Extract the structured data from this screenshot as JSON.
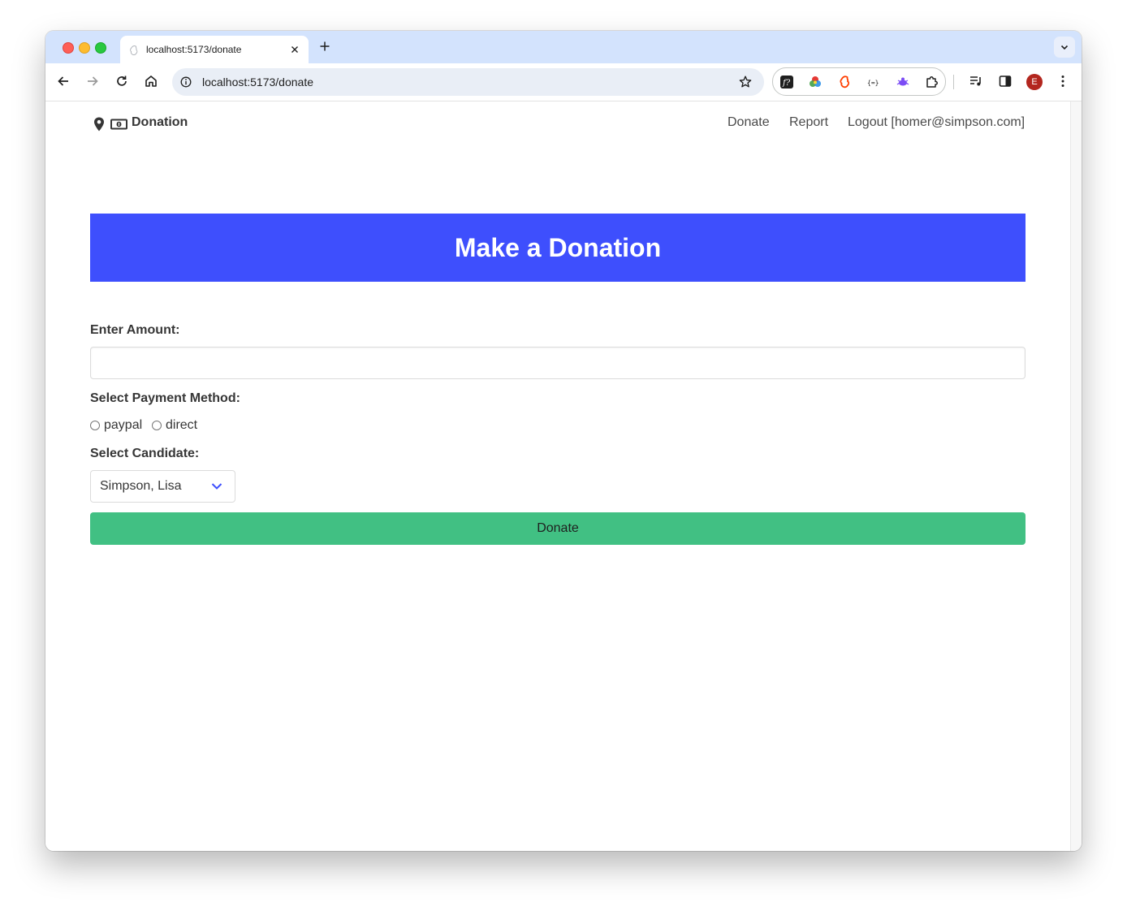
{
  "browser": {
    "tab_title": "localhost:5173/donate",
    "url": "localhost:5173/donate",
    "profile_initial": "E"
  },
  "navbar": {
    "brand": "Donation",
    "links": [
      "Donate",
      "Report",
      "Logout [homer@simpson.com]"
    ]
  },
  "hero": {
    "title": "Make a Donation"
  },
  "form": {
    "amount_label": "Enter Amount:",
    "amount_value": "",
    "payment_label": "Select Payment Method:",
    "payment_options": [
      "paypal",
      "direct"
    ],
    "candidate_label": "Select Candidate:",
    "candidate_selected": "Simpson, Lisa",
    "submit_label": "Donate"
  },
  "colors": {
    "hero_bg": "#3e4ffd",
    "button_bg": "#41c083",
    "tabbar_bg": "#d3e3fd"
  }
}
